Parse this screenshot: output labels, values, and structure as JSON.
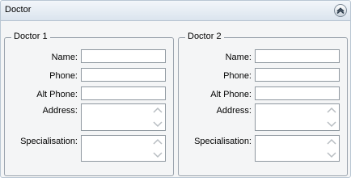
{
  "panel": {
    "title": "Doctor",
    "collapse_icon": "chevron-up-circle-icon"
  },
  "doctor1": {
    "legend": "Doctor 1",
    "name_label": "Name:",
    "name_value": "",
    "phone_label": "Phone:",
    "phone_value": "",
    "alt_phone_label": "Alt Phone:",
    "alt_phone_value": "",
    "address_label": "Address:",
    "address_value": "",
    "specialisation_label": "Specialisation:",
    "specialisation_value": ""
  },
  "doctor2": {
    "legend": "Doctor 2",
    "name_label": "Name:",
    "name_value": "",
    "phone_label": "Phone:",
    "phone_value": "",
    "alt_phone_label": "Alt Phone:",
    "alt_phone_value": "",
    "address_label": "Address:",
    "address_value": "",
    "specialisation_label": "Specialisation:",
    "specialisation_value": ""
  }
}
